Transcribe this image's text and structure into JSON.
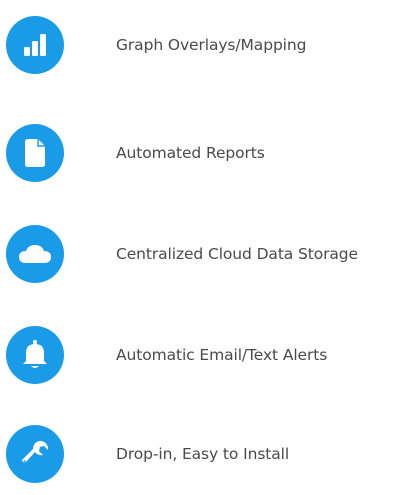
{
  "accent_color": "#1a9be8",
  "features": [
    {
      "icon": "bar-chart-icon",
      "label": "Graph Overlays/Mapping"
    },
    {
      "icon": "document-icon",
      "label": "Automated Reports"
    },
    {
      "icon": "cloud-icon",
      "label": "Centralized Cloud Data Storage"
    },
    {
      "icon": "bell-icon",
      "label": "Automatic Email/Text Alerts"
    },
    {
      "icon": "wrench-icon",
      "label": "Drop-in, Easy to Install"
    }
  ]
}
